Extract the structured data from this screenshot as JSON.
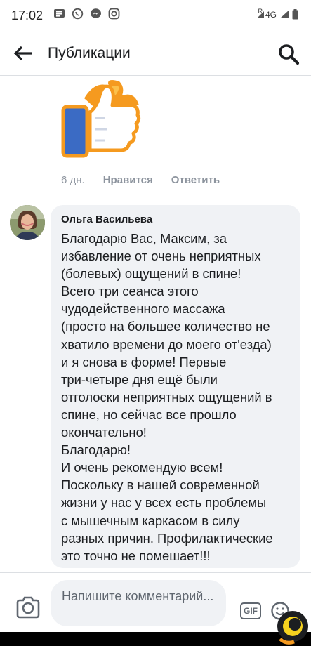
{
  "status_bar": {
    "time": "17:02",
    "network": "4G",
    "roaming": "R",
    "apps": [
      "messages-icon",
      "whatsapp-icon",
      "messenger-icon",
      "instagram-icon"
    ]
  },
  "header": {
    "title": "Публикации",
    "back_icon": "arrow-left-icon",
    "search_icon": "search-icon"
  },
  "previous_comment": {
    "sticker": "thumbs-up-fire-sticker",
    "time": "6 дн.",
    "like_label": "Нравится",
    "reply_label": "Ответить"
  },
  "comment": {
    "author": "Ольга Васильева",
    "text": "Благодарю Вас, Максим, за\nизбавление от очень неприятных\n(болевых) ощущений в спине!\nВсего три сеанса этого\nчудодейственного массажа\n(просто на большее количество не\nхватило времени до моего от'езда)\nи я снова в форме! Первые\nтри-четыре дня ещё были\nотголоски неприятных ощущений в\nспине, но сейчас все прошло\nокончательно!\nБлагодарю!\nИ очень рекомендую всем!\nПоскольку в нашей современной\nжизни у нас у всех есть проблемы\nс мышечным каркасом в силу\nразных причин. Профилактические\nэто точно не помешает!!!"
  },
  "composer": {
    "placeholder": "Напишите комментарий...",
    "camera_icon": "camera-icon",
    "gif_label": "GIF",
    "emoji_icon": "emoji-icon"
  },
  "colors": {
    "bubble": "#f0f2f5",
    "meta_text": "#8d949e",
    "sticker_blue": "#3b6bc4",
    "sticker_orange": "#f59a1f"
  }
}
